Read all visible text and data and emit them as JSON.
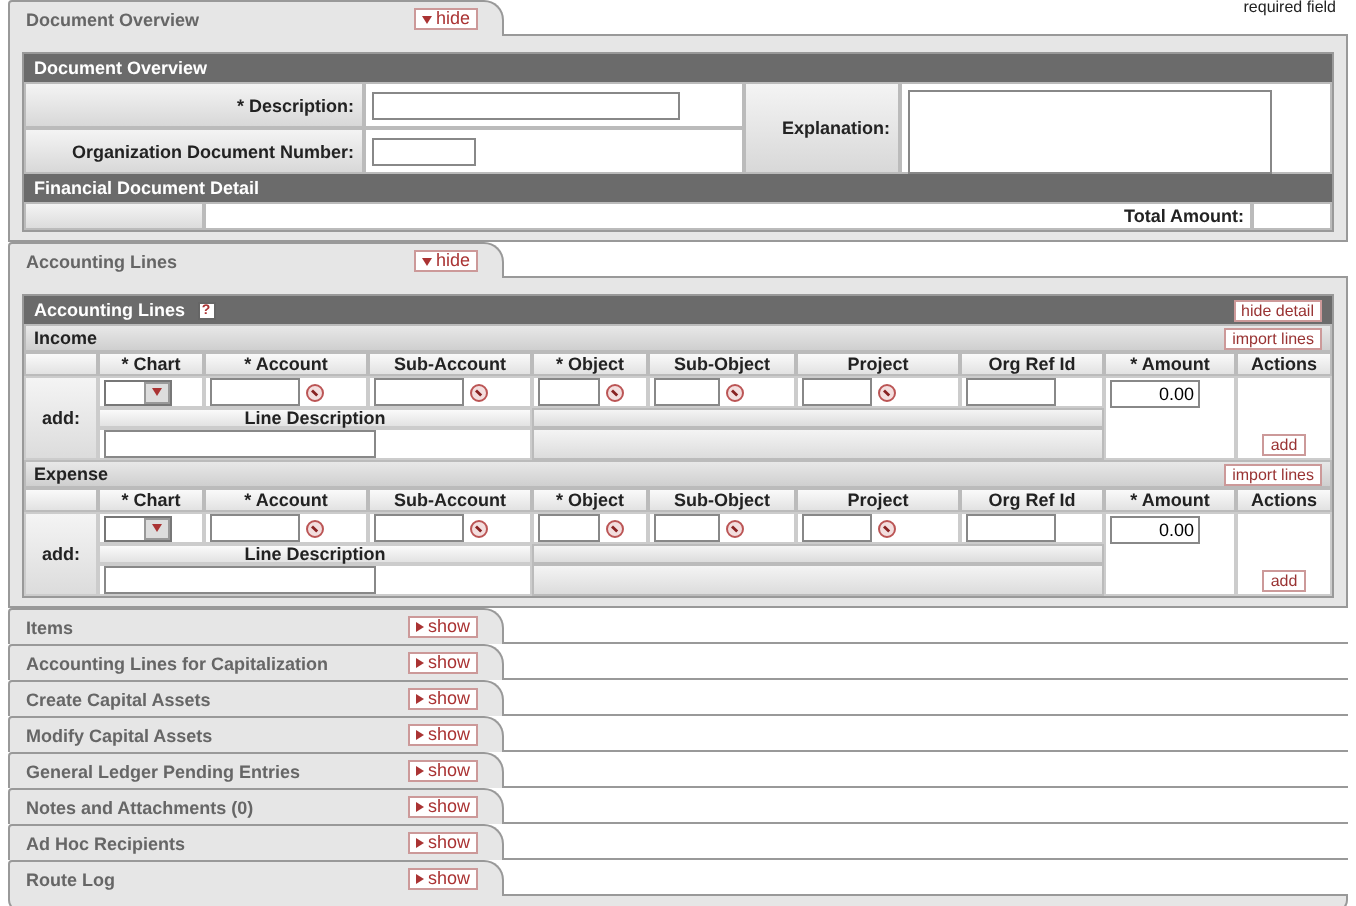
{
  "required_note": "required field",
  "sections": [
    {
      "kind": "overview",
      "title": "Document Overview",
      "toggle": "hide",
      "expanded": true,
      "panel": {
        "title": "Document Overview",
        "fields": [
          {
            "label": "* Description:",
            "wide": true
          },
          {
            "label": "Organization Document Number:",
            "wide": false
          }
        ],
        "explanation_label": "Explanation:",
        "detail_title": "Financial Document Detail",
        "total_label": "Total Amount:"
      }
    },
    {
      "kind": "accounting",
      "title": "Accounting Lines",
      "toggle": "hide",
      "expanded": true,
      "panel": {
        "title": "Accounting Lines",
        "help": "?",
        "hide_detail": "hide detail",
        "groups": [
          {
            "name": "Income",
            "import": "import lines",
            "row_label": "add:",
            "line_description": "Line Description",
            "amount": "0.00",
            "action": "add",
            "columns": [
              {
                "label": "* Chart",
                "kind": "select"
              },
              {
                "label": "* Account",
                "kind": "lookup"
              },
              {
                "label": "Sub-Account",
                "kind": "lookup"
              },
              {
                "label": "* Object",
                "kind": "lookup"
              },
              {
                "label": "Sub-Object",
                "kind": "lookup"
              },
              {
                "label": "Project",
                "kind": "lookup"
              },
              {
                "label": "Org Ref Id",
                "kind": "text"
              },
              {
                "label": "* Amount",
                "kind": "amount"
              },
              {
                "label": "Actions",
                "kind": "actions"
              }
            ]
          },
          {
            "name": "Expense",
            "import": "import lines",
            "row_label": "add:",
            "line_description": "Line Description",
            "amount": "0.00",
            "action": "add",
            "columns": [
              {
                "label": "* Chart",
                "kind": "select"
              },
              {
                "label": "* Account",
                "kind": "lookup"
              },
              {
                "label": "Sub-Account",
                "kind": "lookup"
              },
              {
                "label": "* Object",
                "kind": "lookup"
              },
              {
                "label": "Sub-Object",
                "kind": "lookup"
              },
              {
                "label": "Project",
                "kind": "lookup"
              },
              {
                "label": "Org Ref Id",
                "kind": "text"
              },
              {
                "label": "* Amount",
                "kind": "amount"
              },
              {
                "label": "Actions",
                "kind": "actions"
              }
            ]
          }
        ]
      }
    },
    {
      "kind": "collapsed",
      "title": "Items",
      "toggle": "show",
      "expanded": false
    },
    {
      "kind": "collapsed",
      "title": "Accounting Lines for Capitalization",
      "toggle": "show",
      "expanded": false
    },
    {
      "kind": "collapsed",
      "title": "Create Capital Assets",
      "toggle": "show",
      "expanded": false
    },
    {
      "kind": "collapsed",
      "title": "Modify Capital Assets",
      "toggle": "show",
      "expanded": false
    },
    {
      "kind": "collapsed",
      "title": "General Ledger Pending Entries",
      "toggle": "show",
      "expanded": false
    },
    {
      "kind": "collapsed",
      "title": "Notes and Attachments (0)",
      "toggle": "show",
      "expanded": false
    },
    {
      "kind": "collapsed",
      "title": "Ad Hoc Recipients",
      "toggle": "show",
      "expanded": false
    },
    {
      "kind": "collapsed",
      "title": "Route Log",
      "toggle": "show",
      "expanded": false
    }
  ]
}
